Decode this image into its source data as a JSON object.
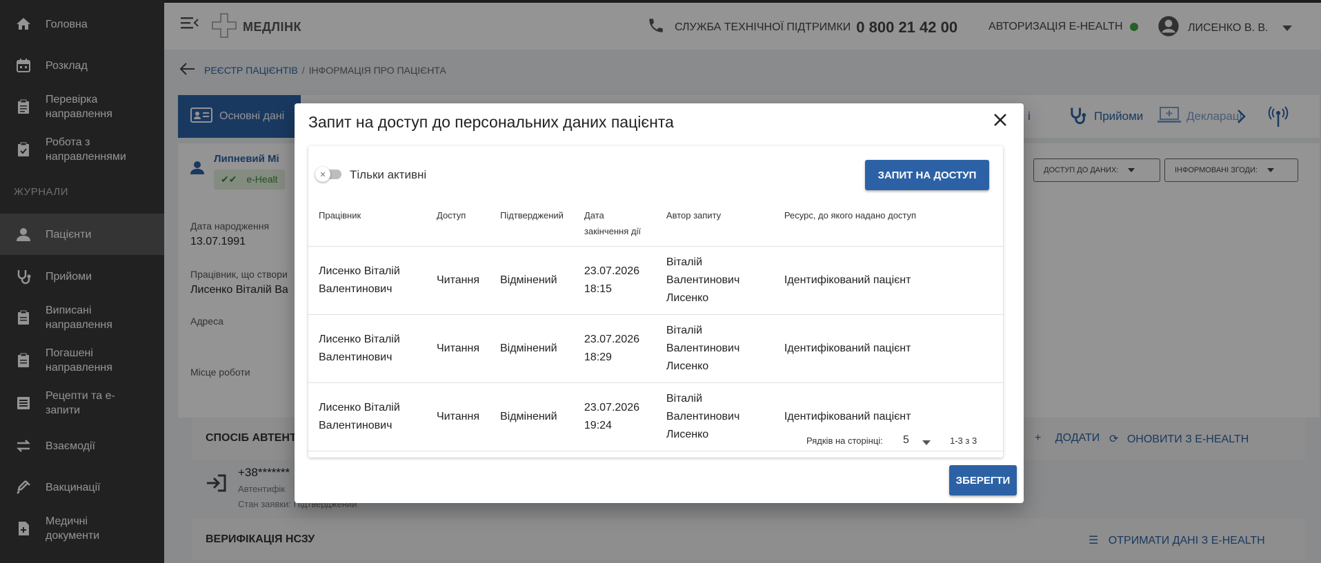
{
  "sidebar": {
    "items": [
      {
        "label": "Головна",
        "icon": "home-icon"
      },
      {
        "label": "Розклад",
        "icon": "calendar-icon"
      },
      {
        "label": "Перевірка направлення",
        "icon": "clipboard-icon"
      },
      {
        "label": "Робота з направленнями",
        "icon": "clipboard-check-icon"
      },
      {
        "label": "Пацієнти",
        "icon": "person-icon"
      },
      {
        "label": "Прийоми",
        "icon": "stethoscope-icon"
      },
      {
        "label": "Виписані направлення",
        "icon": "clipboard-icon"
      },
      {
        "label": "Погашені направлення",
        "icon": "clipboard-icon"
      },
      {
        "label": "Рецепти та е-запити",
        "icon": "list-icon"
      },
      {
        "label": "Взаємодії",
        "icon": "swap-icon"
      },
      {
        "label": "Вакцинації",
        "icon": "syringe-icon"
      },
      {
        "label": "Медичні документи",
        "icon": "doc-plus-icon"
      }
    ],
    "section_journals": "ЖУРНАЛИ"
  },
  "header": {
    "logo": "МЕДЛІНК",
    "support_label": "СЛУЖБА ТЕХНІЧНОЇ ПІДТРИМКИ",
    "support_phone": "0 800 21 42 00",
    "auth_label": "АВТОРИЗАЦІЯ Е-HEALTH",
    "user_name": "ЛИСЕНКО В. В."
  },
  "breadcrumb": {
    "registry": "РЕЄСТР ПАЦІЄНТІВ",
    "separator": "/",
    "current": "ІНФОРМАЦІЯ ПРО ПАЦІЄНТА"
  },
  "tabs": {
    "basic": "Основні дані",
    "partial": "і",
    "appointments": "Прийоми",
    "declarations": "Деклараці"
  },
  "patient": {
    "name": "Липневий Мі",
    "ehealth": "e-Healt",
    "access_dropdown": "ДОСТУП ДО ДАНИХ:",
    "consent_dropdown": "ІНФОРМОВАНІ ЗГОДИ:"
  },
  "details": {
    "birth_label": "Дата народження",
    "birth_value": "13.07.1991",
    "creator_label": "Працівник, що створи",
    "creator_value": "Лисенко Віталій Ва",
    "address_label": "Адреса",
    "work_label": "Місце роботи"
  },
  "auth_section": {
    "title": "СПОСІБ АВТЕНТИ",
    "add": "ДОДАТИ",
    "renew": "ОНОВИТИ З Е-HEALTH",
    "phone": "+38*******",
    "sub1": "Автентифік",
    "sub2": "Стан заявки: Підтверджений"
  },
  "nszu": {
    "title": "ВЕРИФІКАЦІЯ НСЗУ",
    "link": "ОТРИМАТИ ДАНІ З Е-HEALTH"
  },
  "modal": {
    "title": "Запит на доступ до персональних даних пацієнта",
    "toggle_label": "Тільки активні",
    "access_button": "ЗАПИТ НА ДОСТУП",
    "columns": [
      "Працівник",
      "Доступ",
      "Підтверджений",
      "Дата закінчення дії",
      "Автор запиту",
      "Ресурс, до якого надано доступ"
    ],
    "rows": [
      [
        "Лисенко Віталій Валентинович",
        "Читання",
        "Відмінений",
        "23.07.2026 18:15",
        "Віталій Валентинович Лисенко",
        "Ідентифікований пацієнт"
      ],
      [
        "Лисенко Віталій Валентинович",
        "Читання",
        "Відмінений",
        "23.07.2026 18:29",
        "Віталій Валентинович Лисенко",
        "Ідентифікований пацієнт"
      ],
      [
        "Лисенко Віталій Валентинович",
        "Читання",
        "Відмінений",
        "23.07.2026 19:24",
        "Віталій Валентинович Лисенко",
        "Ідентифікований пацієнт"
      ]
    ],
    "rows_per_page_label": "Рядків на сторінці:",
    "rows_per_page_value": "5",
    "range": "1-3 з 3",
    "save": "ЗБЕРЕГТИ"
  },
  "colors": {
    "primary": "#2c62a5",
    "sidebar": "#3a3a3a",
    "status_green": "#3fa843"
  }
}
